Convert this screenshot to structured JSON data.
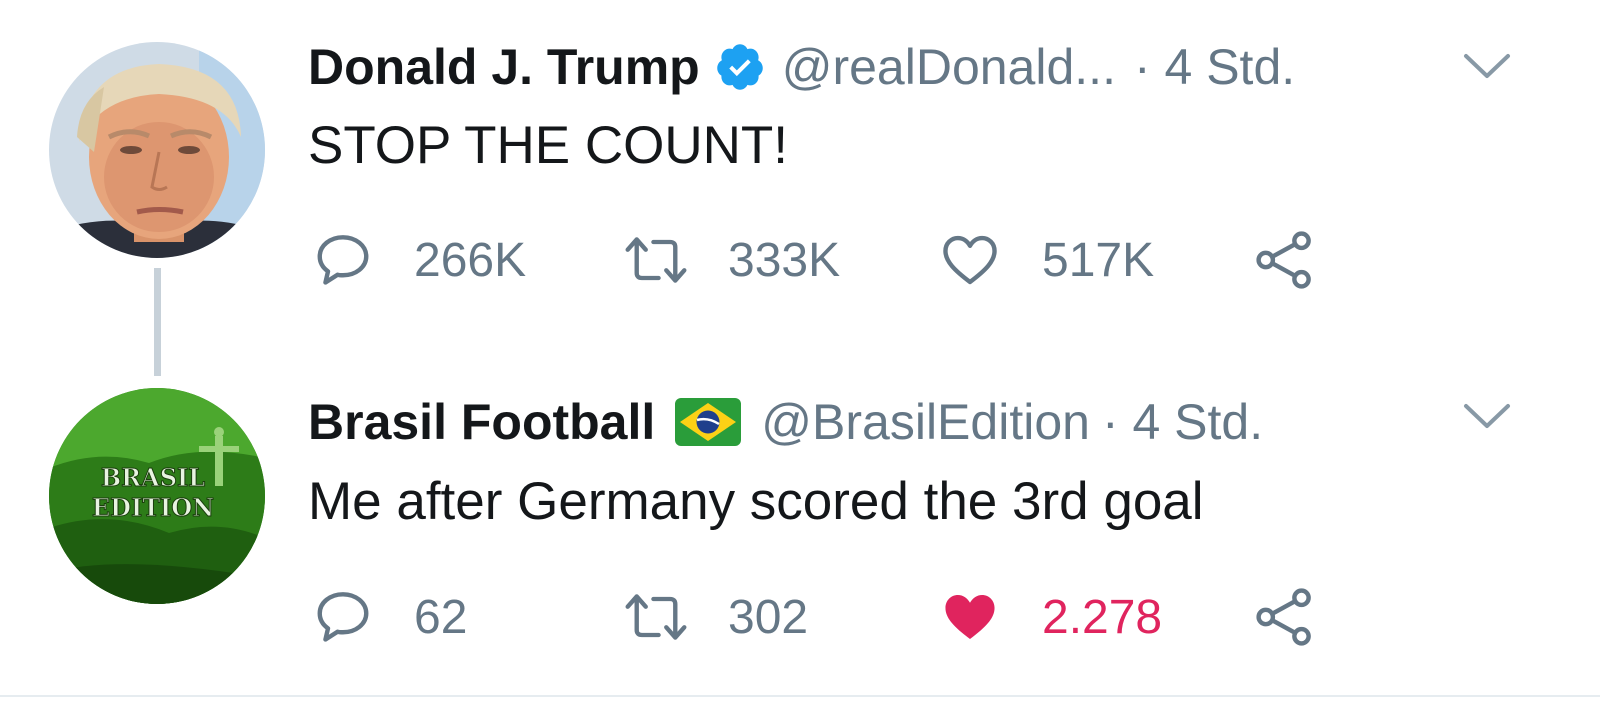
{
  "tweets": [
    {
      "name": "Donald J. Trump",
      "handle": "@realDonald...",
      "time": "· 4 Std.",
      "text": "STOP THE COUNT!",
      "verified": true,
      "replies": "266K",
      "retweets": "333K",
      "likes": "517K",
      "liked": false
    },
    {
      "name": "Brasil Football",
      "handle": "@BrasilEdition",
      "time": "· 4 Std.",
      "text": "Me after Germany scored the 3rd goal",
      "verified": false,
      "replies": "62",
      "retweets": "302",
      "likes": "2.278",
      "liked": true,
      "avatar_logo_text": [
        "BRASIL",
        "EDITION"
      ]
    }
  ],
  "colors": {
    "primary_text": "#14171a",
    "secondary_text": "#657786",
    "like_active": "#e0245e",
    "verified_blue": "#1da1f2",
    "thread_line": "#c7d1d9"
  },
  "icons": {
    "reply": "speech-bubble-icon",
    "retweet": "retweet-arrows-icon",
    "like": "heart-icon",
    "share": "share-nodes-icon",
    "more": "chevron-down-icon",
    "verified": "verified-badge-icon",
    "flag": "brazil-flag-icon"
  }
}
